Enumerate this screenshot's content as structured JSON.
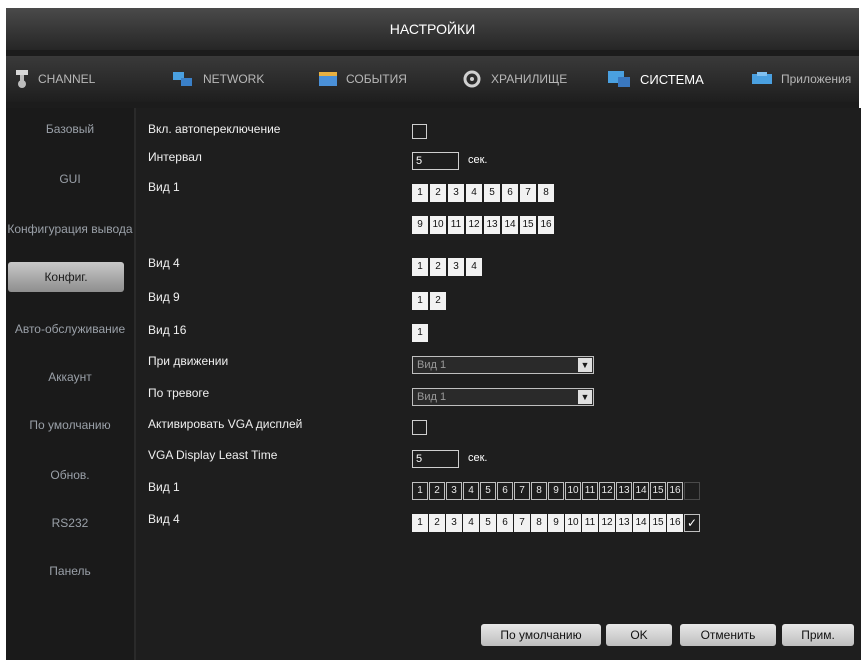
{
  "title": "НАСТРОЙКИ",
  "tabs": [
    {
      "label": "CHANNEL",
      "icon": "channel-icon"
    },
    {
      "label": "NETWORK",
      "icon": "network-icon"
    },
    {
      "label": "СОБЫТИЯ",
      "icon": "events-icon"
    },
    {
      "label": "ХРАНИЛИЩЕ",
      "icon": "storage-icon"
    },
    {
      "label": "СИСТЕМА",
      "icon": "system-icon",
      "active": true
    },
    {
      "label": "Приложения",
      "icon": "apps-icon"
    }
  ],
  "sidebar": {
    "items": [
      {
        "label": "Базовый"
      },
      {
        "label": "GUI"
      },
      {
        "label": "Конфигурация вывода"
      },
      {
        "label": "Конфиг.",
        "active": true
      },
      {
        "label": "Авто-обслуживание"
      },
      {
        "label": "Аккаунт"
      },
      {
        "label": "По умолчанию"
      },
      {
        "label": "Обнов."
      },
      {
        "label": "RS232"
      },
      {
        "label": "Панель"
      }
    ]
  },
  "form": {
    "auto_switch": {
      "label": "Вкл. автопереключение",
      "checked": false
    },
    "interval": {
      "label": "Интервал",
      "value": "5",
      "unit": "сек."
    },
    "view1": {
      "label": "Вид 1",
      "row1": [
        "1",
        "2",
        "3",
        "4",
        "5",
        "6",
        "7",
        "8"
      ],
      "row2": [
        "9",
        "10",
        "11",
        "12",
        "13",
        "14",
        "15",
        "16"
      ]
    },
    "view4": {
      "label": "Вид 4",
      "cells": [
        "1",
        "2",
        "3",
        "4"
      ]
    },
    "view9": {
      "label": "Вид 9",
      "cells": [
        "1",
        "2"
      ]
    },
    "view16": {
      "label": "Вид 16",
      "cells": [
        "1"
      ]
    },
    "on_motion": {
      "label": "При движении",
      "value": "Вид 1"
    },
    "on_alarm": {
      "label": "По тревоге",
      "value": "Вид 1"
    },
    "vga_display": {
      "label": "Активировать VGA дисплей",
      "checked": false
    },
    "vga_least_time": {
      "label": "VGA Display Least Time",
      "value": "5",
      "unit": "сек."
    },
    "vga_view1": {
      "label": "Вид 1",
      "cells": [
        "1",
        "2",
        "3",
        "4",
        "5",
        "6",
        "7",
        "8",
        "9",
        "10",
        "11",
        "12",
        "13",
        "14",
        "15",
        "16"
      ],
      "all_checked": false
    },
    "vga_view4": {
      "label": "Вид 4",
      "cells": [
        "1",
        "2",
        "3",
        "4",
        "5",
        "6",
        "7",
        "8",
        "9",
        "10",
        "11",
        "12",
        "13",
        "14",
        "15",
        "16"
      ],
      "all_checked": true,
      "check_mark": "✓"
    }
  },
  "buttons": {
    "default": "По умолчанию",
    "ok": "OK",
    "cancel": "Отменить",
    "apply": "Прим."
  },
  "colors": {
    "background": "#1c1c1c",
    "text": "#ffffff",
    "active_tab": "#ffffff",
    "sidebar_text": "#9aa0a8"
  }
}
